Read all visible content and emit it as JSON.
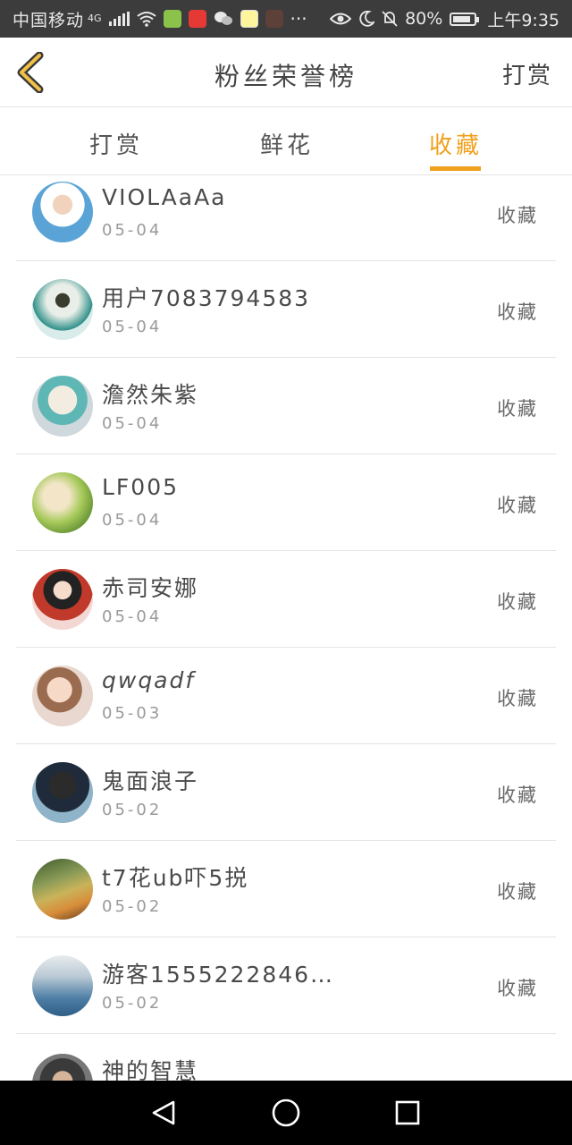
{
  "status_bar": {
    "carrier": "中国移动",
    "network": "4G",
    "more": "···",
    "battery": "80%",
    "time": "上午9:35"
  },
  "header": {
    "title": "粉丝荣誉榜",
    "right_action": "打赏",
    "back_icon": "chevron-left-icon"
  },
  "tabs": [
    {
      "label": "打赏",
      "active": false
    },
    {
      "label": "鲜花",
      "active": false
    },
    {
      "label": "收藏",
      "active": true
    }
  ],
  "accent_color": "#f0a01c",
  "list": [
    {
      "name": "VIOLAaAa",
      "date": "05-04",
      "label": "收藏"
    },
    {
      "name": "用户7083794583",
      "date": "05-04",
      "label": "收藏"
    },
    {
      "name": "澹然朱紫",
      "date": "05-04",
      "label": "收藏"
    },
    {
      "name": "LF005",
      "date": "05-04",
      "label": "收藏"
    },
    {
      "name": "赤司安娜",
      "date": "05-04",
      "label": "收藏"
    },
    {
      "name": "qwqadf",
      "date": "05-03",
      "label": "收藏"
    },
    {
      "name": "鬼面浪子",
      "date": "05-02",
      "label": "收藏"
    },
    {
      "name": "t7花ub吓5捝",
      "date": "05-02",
      "label": "收藏"
    },
    {
      "name": "游客1555222846…",
      "date": "05-02",
      "label": "收藏"
    },
    {
      "name": "神的智慧",
      "date": "",
      "label": ""
    }
  ]
}
